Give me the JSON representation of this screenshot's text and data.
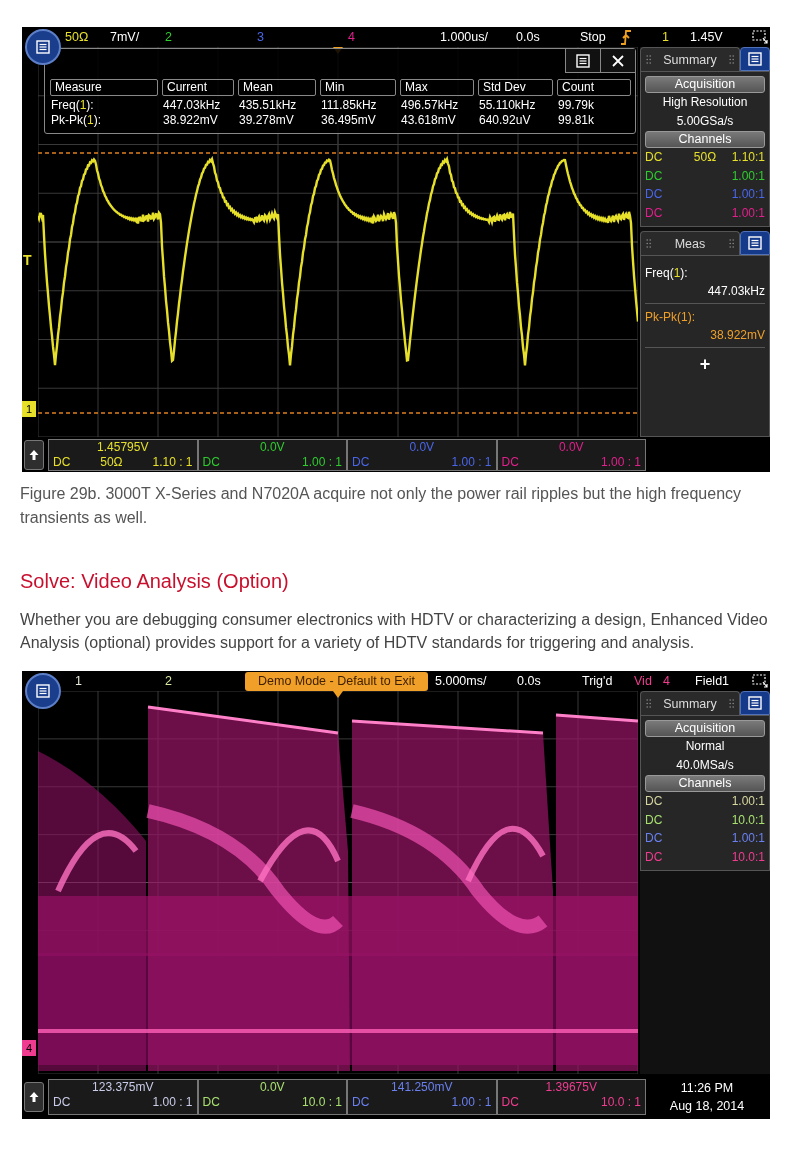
{
  "blocks": [
    {
      "kind": "scope",
      "trace": {
        "kind": "ripple"
      },
      "top_bar": [
        {
          "kind": "text",
          "text": "50Ω",
          "color": "#e6e02a"
        },
        {
          "kind": "text",
          "text": "7mV/",
          "color": "#ffffff"
        },
        {
          "kind": "text",
          "text": "2",
          "color": "#2ecc2e"
        },
        {
          "kind": "text",
          "text": "3",
          "color": "#4a66e8"
        },
        {
          "kind": "text",
          "text": "4",
          "color": "#e0208c"
        },
        {
          "kind": "text",
          "text": "1.000us/",
          "color": "#ffffff"
        },
        {
          "kind": "text",
          "text": "0.0s",
          "color": "#ffffff"
        },
        {
          "kind": "text",
          "text": "Stop",
          "color": "#ffffff"
        },
        {
          "kind": "trigger"
        },
        {
          "kind": "text",
          "text": "1",
          "color": "#e6e02a"
        },
        {
          "kind": "text",
          "text": "1.45V",
          "color": "#ffffff"
        }
      ],
      "markers": [
        {
          "kind": "trigger_level",
          "text": "T",
          "color": "#e6e02a"
        },
        {
          "kind": "ground",
          "text": "1",
          "color": "#e6e02a"
        }
      ],
      "measurements": {
        "columns": [
          "Measure",
          "Current",
          "Mean",
          "Min",
          "Max",
          "Std Dev",
          "Count"
        ],
        "rows": [
          [
            "Freq(**1**):",
            "447.03kHz",
            "435.51kHz",
            "111.85kHz",
            "496.57kHz",
            "55.110kHz",
            "99.79k"
          ],
          [
            "Pk-Pk(**1**):",
            "38.922mV",
            "39.278mV",
            "36.495mV",
            "43.618mV",
            "640.92uV",
            "99.81k"
          ]
        ]
      },
      "summary": {
        "tab": "Summary",
        "acquisition_header": "Acquisition",
        "mode": "High Resolution",
        "rate": "5.00GSa/s",
        "channels_header": "Channels",
        "channels": [
          {
            "coupling": "DC",
            "impedance": "50Ω",
            "ratio": "1.10:1",
            "color": "#e6e02a"
          },
          {
            "coupling": "DC",
            "ratio": "1.00:1",
            "color": "#2ecc2e"
          },
          {
            "coupling": "DC",
            "ratio": "1.00:1",
            "color": "#4a66e8"
          },
          {
            "coupling": "DC",
            "ratio": "1.00:1",
            "color": "#e0208c"
          }
        ]
      },
      "meas_panel": {
        "tab": "Meas",
        "items": [
          {
            "label": "Freq(**1**):",
            "value": "447.03kHz",
            "selected": false
          },
          {
            "label": "Pk-Pk(1):",
            "value": "38.922mV",
            "selected": true
          }
        ],
        "add": "+"
      },
      "channel_bar": [
        {
          "offset": "1.45795V",
          "coupling": "DC",
          "impedance": "50Ω",
          "ratio": "1.10 : 1",
          "color": "#e6e02a"
        },
        {
          "offset": "0.0V",
          "coupling": "DC",
          "ratio": "1.00 : 1",
          "color": "#2ecc2e"
        },
        {
          "offset": "0.0V",
          "coupling": "DC",
          "ratio": "1.00 : 1",
          "color": "#4a66e8"
        },
        {
          "offset": "0.0V",
          "coupling": "DC",
          "ratio": "1.00 : 1",
          "color": "#e0208c"
        }
      ]
    },
    {
      "kind": "caption",
      "text": "Figure 29b. 3000T X-Series and N7020A acquire not only the power rail ripples but the high frequency transients as well."
    },
    {
      "kind": "heading",
      "text": "Solve: Video Analysis (Option)"
    },
    {
      "kind": "paragraph",
      "text": "Whether you are debugging consumer electronics with HDTV or characterizing a design, Enhanced Video Analysis (optional) provides support for a variety of HDTV standards for triggering and analysis."
    },
    {
      "kind": "scope",
      "trace": {
        "kind": "video"
      },
      "top_bar": [
        {
          "kind": "text",
          "text": "1",
          "color": "#e8e8d8"
        },
        {
          "kind": "text",
          "text": "2",
          "color": "#d8e8a0"
        },
        {
          "kind": "banner",
          "text": "Demo Mode - Default to Exit"
        },
        {
          "kind": "text",
          "text": "5.000ms/",
          "color": "#ffffff"
        },
        {
          "kind": "text",
          "text": "0.0s",
          "color": "#ffffff"
        },
        {
          "kind": "text",
          "text": "Trig'd",
          "color": "#ffffff"
        },
        {
          "kind": "text",
          "text": "Vid",
          "color": "#f03c90"
        },
        {
          "kind": "text",
          "text": "4",
          "color": "#f03c90"
        },
        {
          "kind": "text",
          "text": "Field1",
          "color": "#ffffff"
        }
      ],
      "markers": [
        {
          "kind": "ground",
          "text": "4",
          "color": "#f03c90"
        }
      ],
      "summary": {
        "tab": "Summary",
        "acquisition_header": "Acquisition",
        "mode": "Normal",
        "rate": "40.0MSa/s",
        "channels_header": "Channels",
        "channels": [
          {
            "coupling": "DC",
            "ratio": "1.00:1",
            "color": "#d6d6a0"
          },
          {
            "coupling": "DC",
            "ratio": "10.0:1",
            "color": "#a8e070"
          },
          {
            "coupling": "DC",
            "ratio": "1.00:1",
            "color": "#6a80f0"
          },
          {
            "coupling": "DC",
            "ratio": "10.0:1",
            "color": "#f03c90"
          }
        ]
      },
      "channel_bar": [
        {
          "offset": "123.375mV",
          "coupling": "DC",
          "ratio": "1.00 : 1",
          "color": "#c8cce8"
        },
        {
          "offset": "0.0V",
          "coupling": "DC",
          "ratio": "10.0 : 1",
          "color": "#a8e070"
        },
        {
          "offset": "141.250mV",
          "coupling": "DC",
          "ratio": "1.00 : 1",
          "color": "#6a80f0"
        },
        {
          "offset": "1.39675V",
          "coupling": "DC",
          "ratio": "10.0 : 1",
          "color": "#f03c90"
        }
      ],
      "clock": {
        "time": "11:26 PM",
        "date": "Aug 18, 2014"
      }
    }
  ]
}
